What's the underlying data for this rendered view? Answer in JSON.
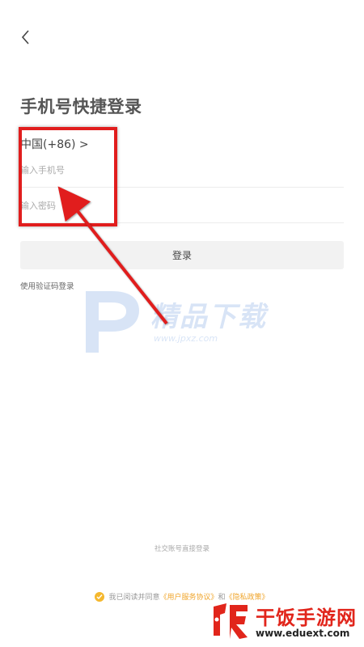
{
  "title": "手机号快捷登录",
  "country_code": "中国(+86) >",
  "phone_placeholder": "输入手机号",
  "password_placeholder": "输入密码",
  "login_label": "登录",
  "sms_login_label": "使用验证码登录",
  "watermark": {
    "name": "精品下载",
    "url": "www.jpxz.com"
  },
  "social_login_label": "社交账号直接登录",
  "agreement": {
    "prefix": "我已阅读并同意",
    "user_terms": "《用户服务协议》",
    "and": "和",
    "privacy": "《隐私政策》"
  },
  "site_watermark": {
    "name": "干饭手游网",
    "url": "www.eduext.com"
  },
  "colors": {
    "accent": "#f0a52b",
    "annotation": "#e11d1d"
  }
}
